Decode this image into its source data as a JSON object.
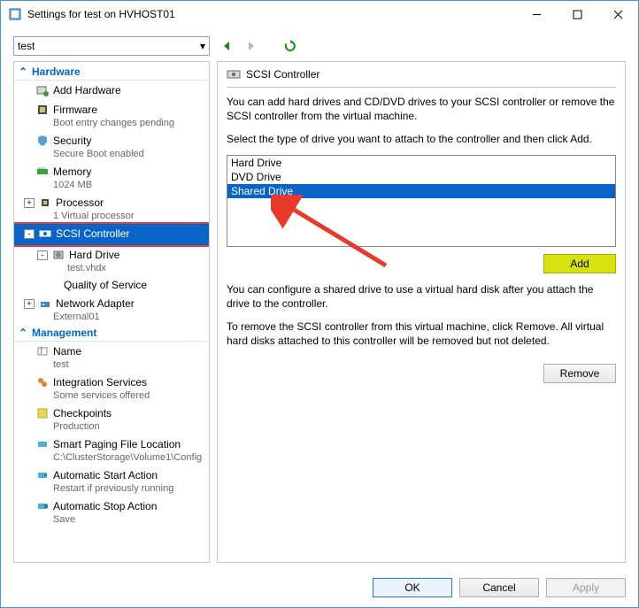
{
  "window": {
    "title": "Settings for test on HVHOST01"
  },
  "topbar": {
    "selected": "test"
  },
  "tree": {
    "hardware_label": "Hardware",
    "management_label": "Management",
    "add_hw": "Add Hardware",
    "firmware": "Firmware",
    "firmware_sub": "Boot entry changes pending",
    "security": "Security",
    "security_sub": "Secure Boot enabled",
    "memory": "Memory",
    "memory_sub": "1024 MB",
    "processor": "Processor",
    "processor_sub": "1 Virtual processor",
    "scsi": "SCSI Controller",
    "hard_drive": "Hard Drive",
    "hard_drive_sub": "test.vhdx",
    "qos": "Quality of Service",
    "netadapter": "Network Adapter",
    "netadapter_sub": "External01",
    "name": "Name",
    "name_sub": "test",
    "integ": "Integration Services",
    "integ_sub": "Some services offered",
    "ckpt": "Checkpoints",
    "ckpt_sub": "Production",
    "smart": "Smart Paging File Location",
    "smart_sub": "C:\\ClusterStorage\\Volume1\\Config",
    "autostart": "Automatic Start Action",
    "autostart_sub": "Restart if previously running",
    "autostop": "Automatic Stop Action",
    "autostop_sub": "Save"
  },
  "right": {
    "header": "SCSI Controller",
    "p1": "You can add hard drives and CD/DVD drives to your SCSI controller or remove the SCSI controller from the virtual machine.",
    "p2": "Select the type of drive you want to attach to the controller and then click Add.",
    "opts": {
      "hd": "Hard Drive",
      "dvd": "DVD Drive",
      "shared": "Shared Drive"
    },
    "add": "Add",
    "p3": "You can configure a shared drive to use a virtual hard disk after you attach the drive to the controller.",
    "p4": "To remove the SCSI controller from this virtual machine, click Remove. All virtual hard disks attached to this controller will be removed but not deleted.",
    "remove": "Remove"
  },
  "footer": {
    "ok": "OK",
    "cancel": "Cancel",
    "apply": "Apply"
  }
}
